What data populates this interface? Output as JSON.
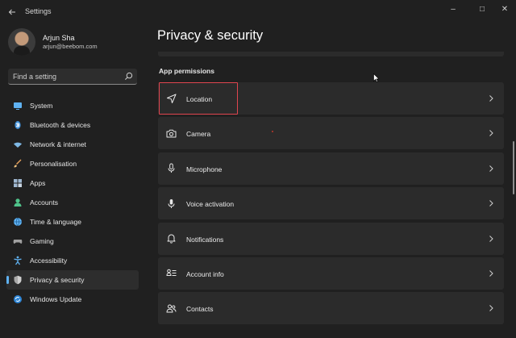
{
  "window": {
    "app_title": "Settings",
    "controls": {
      "minimize": "–",
      "maximize": "□",
      "close": "✕"
    }
  },
  "profile": {
    "name": "Arjun Sha",
    "email": "arjun@beebom.com"
  },
  "search": {
    "placeholder": "Find a setting"
  },
  "sidebar": {
    "items": [
      {
        "label": "System",
        "icon": "monitor-icon",
        "color": "#5fb2f2"
      },
      {
        "label": "Bluetooth & devices",
        "icon": "bluetooth-icon",
        "color": "#5fb2f2"
      },
      {
        "label": "Network & internet",
        "icon": "wifi-icon",
        "color": "#7fb9e6"
      },
      {
        "label": "Personalisation",
        "icon": "brush-icon",
        "color": "#e8a25c"
      },
      {
        "label": "Apps",
        "icon": "apps-icon",
        "color": "#9fb7d0"
      },
      {
        "label": "Accounts",
        "icon": "person-icon",
        "color": "#4fc38a"
      },
      {
        "label": "Time & language",
        "icon": "globe-clock-icon",
        "color": "#5fb2f2"
      },
      {
        "label": "Gaming",
        "icon": "controller-icon",
        "color": "#a0a0a0"
      },
      {
        "label": "Accessibility",
        "icon": "accessibility-icon",
        "color": "#5fb2f2"
      },
      {
        "label": "Privacy & security",
        "icon": "shield-icon",
        "color": "#a8a8a8",
        "active": true
      },
      {
        "label": "Windows Update",
        "icon": "update-icon",
        "color": "#5fb2f2"
      }
    ]
  },
  "main": {
    "title": "Privacy & security",
    "section_label": "App permissions",
    "rows": [
      {
        "label": "Location",
        "icon": "location-arrow-icon"
      },
      {
        "label": "Camera",
        "icon": "camera-icon"
      },
      {
        "label": "Microphone",
        "icon": "microphone-icon"
      },
      {
        "label": "Voice activation",
        "icon": "voice-mic-icon"
      },
      {
        "label": "Notifications",
        "icon": "bell-icon"
      },
      {
        "label": "Account info",
        "icon": "account-info-icon"
      },
      {
        "label": "Contacts",
        "icon": "contacts-icon"
      }
    ]
  },
  "colors": {
    "accent": "#5fb2f2",
    "highlight": "#e0454f",
    "card": "#2b2b2b",
    "background": "#202020"
  }
}
